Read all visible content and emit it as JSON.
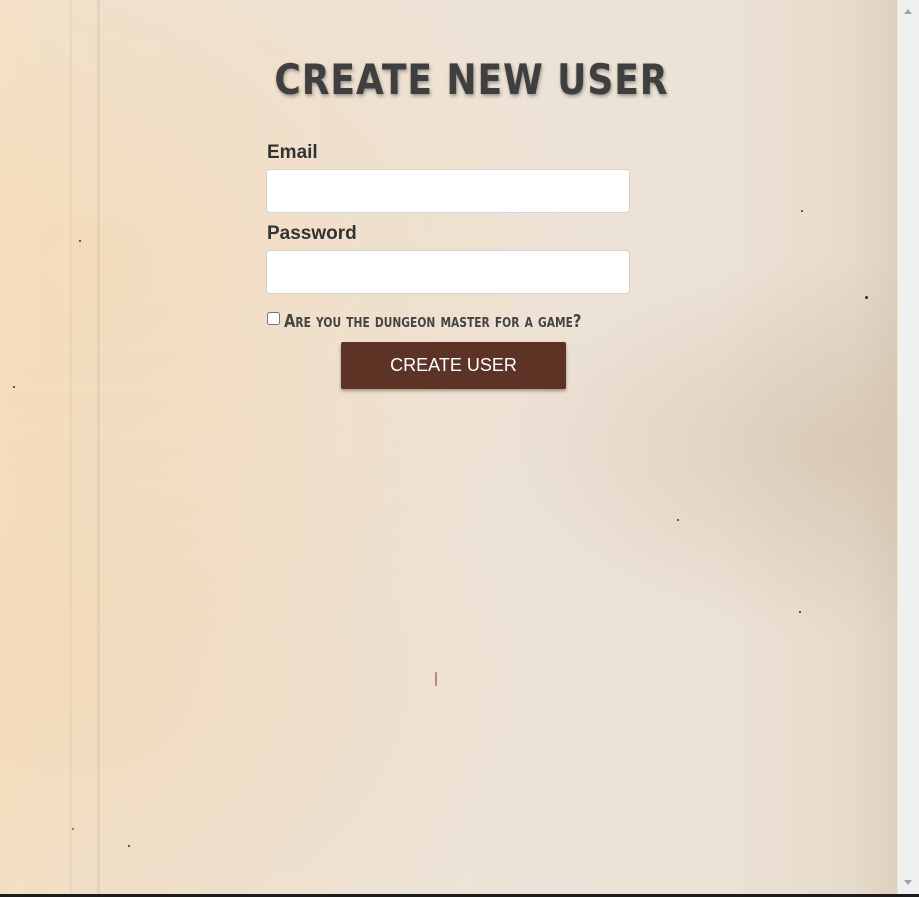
{
  "form": {
    "title": "CREATE NEW USER",
    "email_label": "Email",
    "email_value": "",
    "password_label": "Password",
    "password_value": "",
    "dm_checkbox_label": "Are you the dungeon master for a game?",
    "dm_checked": false,
    "submit_label": "CREATE USER"
  },
  "colors": {
    "button": "#5d3326",
    "title": "#3f3f3f",
    "paper": "#ece2d6"
  }
}
